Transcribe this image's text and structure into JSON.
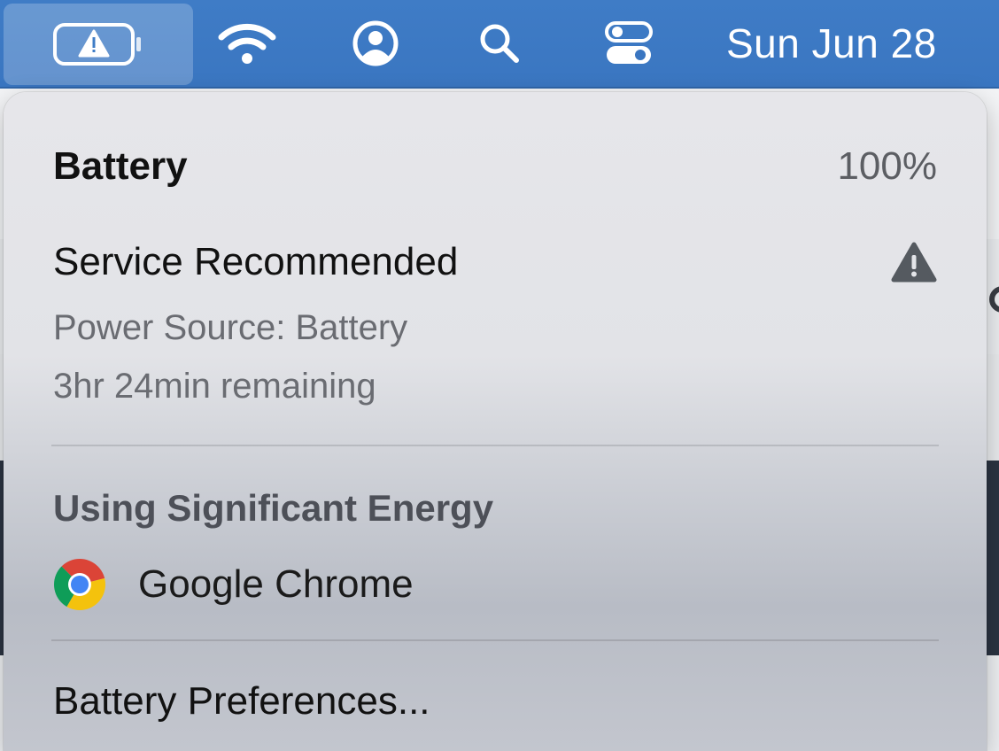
{
  "menubar": {
    "battery_icon": "battery-warning-icon",
    "wifi_icon": "wifi-icon",
    "user_icon": "user-circle-icon",
    "search_icon": "search-icon",
    "control_icon": "control-center-icon",
    "clock": "Sun Jun 28"
  },
  "battery_menu": {
    "title": "Battery",
    "percent": "100%",
    "status": "Service Recommended",
    "status_icon": "warning-icon",
    "power_source": "Power Source: Battery",
    "remaining": "3hr 24min remaining",
    "energy_section": {
      "header": "Using Significant Energy",
      "apps": [
        {
          "name": "Google Chrome",
          "icon": "chrome-icon"
        }
      ]
    },
    "preferences_label": "Battery Preferences..."
  },
  "colors": {
    "menubar": "#3a76c1",
    "panel": "#e4e5e9",
    "warning_icon": "#555a60",
    "chrome_red": "#db4437",
    "chrome_yellow": "#f4c20d",
    "chrome_green": "#0f9d58",
    "chrome_blue": "#4285f4"
  }
}
